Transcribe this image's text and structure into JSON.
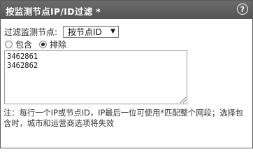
{
  "panel": {
    "title": "按监测节点IP/ID过滤 *",
    "help_icon": "question-circle-icon"
  },
  "filter": {
    "label": "过滤监测节点:",
    "selected_option": "按节点ID",
    "dropdown_icon": "triangle-down-icon"
  },
  "mode": {
    "options": [
      {
        "label": "包含",
        "checked": false
      },
      {
        "label": "排除",
        "checked": true
      }
    ]
  },
  "ids": {
    "lines": [
      "3462861",
      "3462862"
    ]
  },
  "note": {
    "text": "注：每行一个IP或节点ID，IP最后一位可使用*匹配整个网段；选择包含时，城市和运营商选项将失效"
  },
  "colors": {
    "titlebar": "#5e5e5e",
    "border": "#5a5a5a"
  }
}
